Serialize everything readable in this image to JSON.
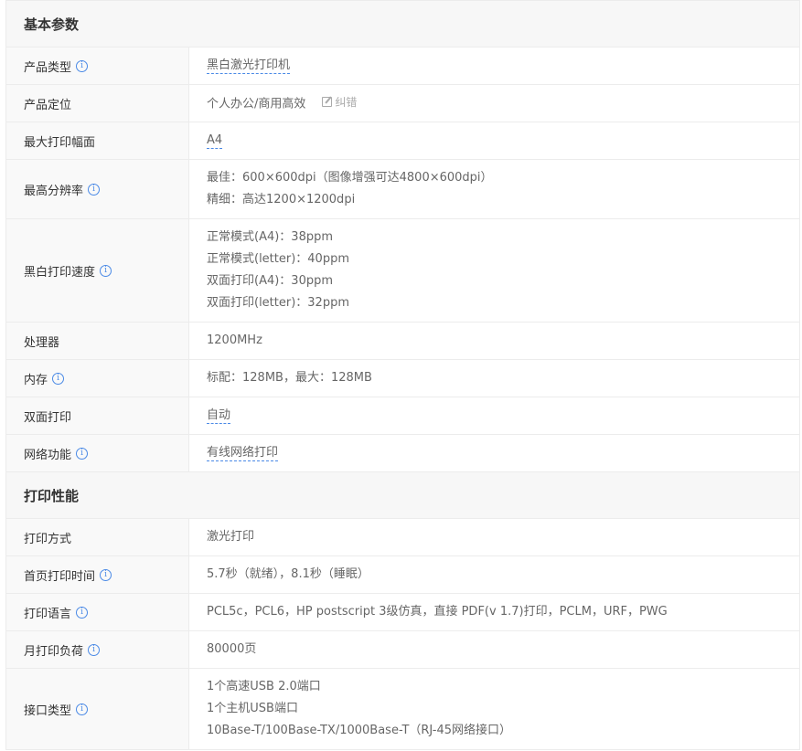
{
  "sections": [
    {
      "title": "基本参数",
      "rows": [
        {
          "label": "产品类型",
          "info": true,
          "lines": [
            "黑白激光打印机"
          ],
          "dashed": true
        },
        {
          "label": "产品定位",
          "info": false,
          "lines": [
            "个人办公/商用高效"
          ],
          "correct": "纠错"
        },
        {
          "label": "最大打印幅面",
          "info": false,
          "lines": [
            "A4"
          ],
          "dashed": true
        },
        {
          "label": "最高分辨率",
          "info": true,
          "lines": [
            "最佳：600×600dpi（图像增强可达4800×600dpi）",
            "精细：高达1200×1200dpi"
          ]
        },
        {
          "label": "黑白打印速度",
          "info": true,
          "lines": [
            "正常模式(A4)：38ppm",
            "正常模式(letter)：40ppm",
            "双面打印(A4)：30ppm",
            "双面打印(letter)：32ppm"
          ]
        },
        {
          "label": "处理器",
          "info": false,
          "lines": [
            "1200MHz"
          ]
        },
        {
          "label": "内存",
          "info": true,
          "lines": [
            "标配：128MB，最大：128MB"
          ]
        },
        {
          "label": "双面打印",
          "info": false,
          "lines": [
            "自动"
          ],
          "dashed": true
        },
        {
          "label": "网络功能",
          "info": true,
          "lines": [
            "有线网络打印"
          ],
          "dashed": true
        }
      ]
    },
    {
      "title": "打印性能",
      "rows": [
        {
          "label": "打印方式",
          "info": false,
          "lines": [
            "激光打印"
          ]
        },
        {
          "label": "首页打印时间",
          "info": true,
          "lines": [
            "5.7秒（就绪），8.1秒（睡眠）"
          ]
        },
        {
          "label": "打印语言",
          "info": true,
          "lines": [
            "PCL5c，PCL6，HP postscript 3级仿真，直接 PDF(v 1.7)打印，PCLM，URF，PWG"
          ]
        },
        {
          "label": "月打印负荷",
          "info": true,
          "lines": [
            "80000页"
          ]
        },
        {
          "label": "接口类型",
          "info": true,
          "lines": [
            "1个高速USB 2.0端口",
            "1个主机USB端口",
            "10Base-T/100Base-TX/1000Base-T（RJ-45网络接口）"
          ]
        }
      ]
    }
  ],
  "info_icon_glyph": "i",
  "colors": {
    "accent": "#4b8ae6",
    "header_bg": "#f7f7f7",
    "border": "#ececec"
  }
}
